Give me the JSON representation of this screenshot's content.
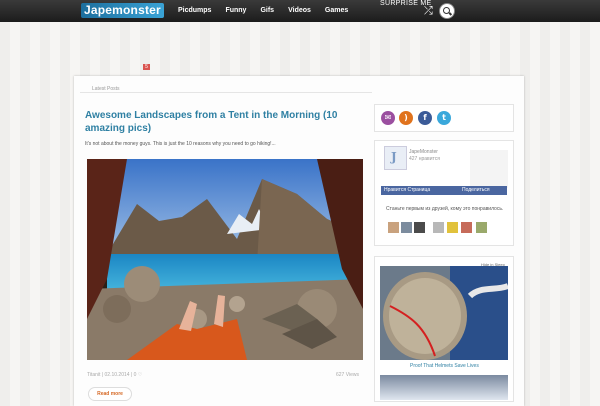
{
  "header": {
    "logo": "Japemonster",
    "nav": [
      "Picdumps",
      "Funny",
      "Gifs",
      "Videos",
      "Games"
    ],
    "surprise": "SURPRISE ME",
    "badge": "5"
  },
  "main": {
    "section_label": "Latest Posts",
    "post": {
      "title": "Awesome Landscapes from a Tent in the Morning (10 amazing pics)",
      "excerpt": "It's not about the money guys. This is just the 10 reasons why you need to go hiking!...",
      "author_date": "Titanit | 02.10.2014",
      "comments": "0",
      "views": "627 Views",
      "read_more": "Read more"
    }
  },
  "sidebar": {
    "social": [
      "email-icon",
      "rss-icon",
      "facebook-icon",
      "twitter-icon"
    ],
    "facebook": {
      "page_name": "JapeMonster",
      "likes": "427 нравится",
      "like_button": "Нравится Страница",
      "share_button": "Поделиться",
      "text": "Станьте первым из друзей, кому это понравилось."
    },
    "ad": {
      "hide": "Hide in Sleep",
      "caption": "Proof That Helmets Save Lives"
    }
  },
  "colors": {
    "accent": "#2f80a3",
    "topbar": "#222222",
    "readmore": "#d66a27",
    "facebook": "#4a66a0"
  }
}
